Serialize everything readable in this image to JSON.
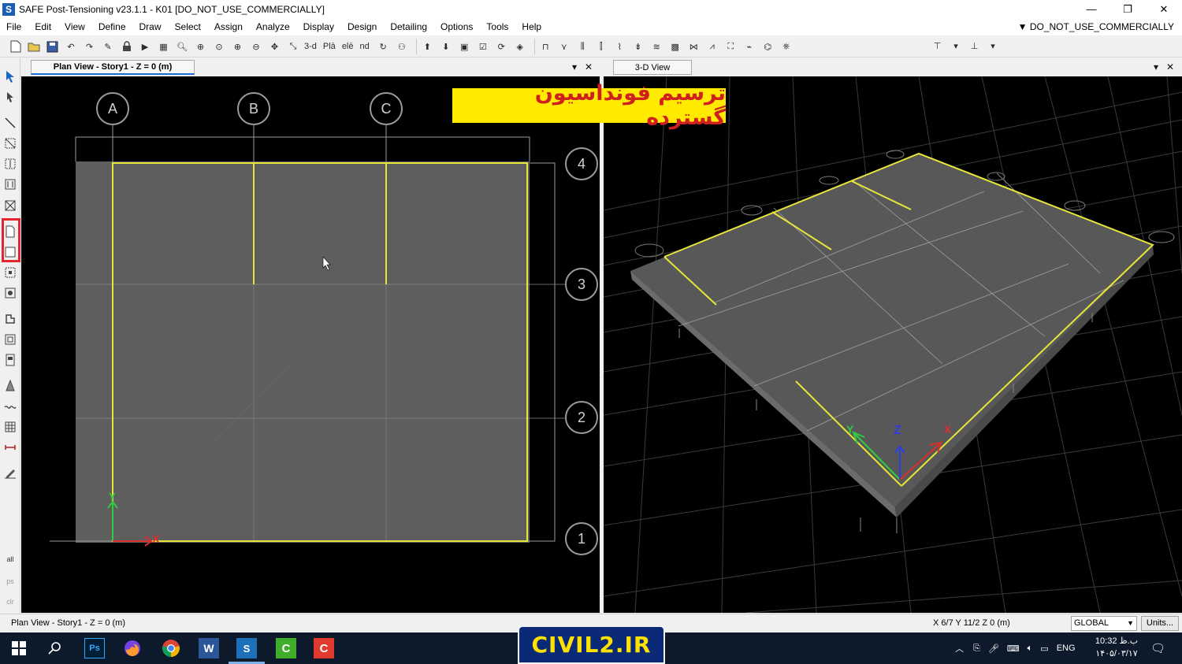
{
  "window": {
    "title": "SAFE Post-Tensioning v23.1.1 - K01  [DO_NOT_USE_COMMERCIALLY]",
    "logo": "S",
    "license_label": "DO_NOT_USE_COMMERCIALLY",
    "minimize_glyph": "—",
    "maximize_glyph": "❐",
    "close_glyph": "✕"
  },
  "menu": {
    "items": [
      "File",
      "Edit",
      "View",
      "Define",
      "Draw",
      "Select",
      "Assign",
      "Analyze",
      "Display",
      "Design",
      "Detailing",
      "Options",
      "Tools",
      "Help"
    ]
  },
  "toolbar": {
    "text_buttons": [
      "3-d",
      "Plā",
      "elē",
      "nd"
    ]
  },
  "panes": {
    "plan_tab": "Plan View - Story1 - Z = 0 (m)",
    "view3d_tab": "3-D View",
    "dropdown_glyph": "▾",
    "close_glyph": "✕"
  },
  "plan": {
    "grid_x_labels": [
      "A",
      "B",
      "C"
    ],
    "grid_y_labels": [
      "4",
      "3",
      "2",
      "1"
    ],
    "axis_x_label": "X",
    "axis_y_label": "Y"
  },
  "view3d": {
    "axis_z_label": "Z"
  },
  "banner": {
    "persian_text": "ترسیم فونداسیون گسترده",
    "site_text": "CIVIL2.IR"
  },
  "status": {
    "left_text": "Plan View - Story1 - Z = 0 (m)",
    "coords_text": "X 6/7  Y 11/2  Z 0 (m)",
    "coord_system": "GLOBAL",
    "units_label": "Units..."
  },
  "taskbar": {
    "lang": "ENG",
    "time": "10:32 ب.ظ",
    "date": "۱۴۰۵/۰۳/۱۷"
  },
  "colors": {
    "accent_red": "#e3262e",
    "grid_yellow": "#e6e63a",
    "banner_yellow": "#ffea00"
  }
}
